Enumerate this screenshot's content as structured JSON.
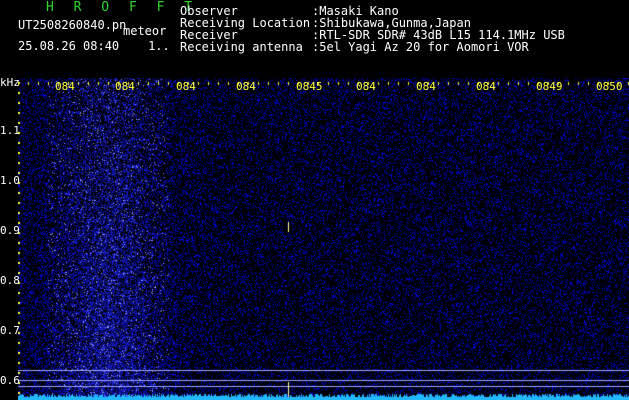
{
  "header": {
    "title": "H R O F F T",
    "filename": "UT2508260840.pn",
    "tag": "meteor",
    "datetime": "25.08.26 08:40",
    "counter": "1.."
  },
  "info": [
    {
      "label": "Observer",
      "value": ":Masaki Kano"
    },
    {
      "label": "Receiving Location",
      "value": ":Shibukawa,Gunma,Japan"
    },
    {
      "label": "Receiver",
      "value": ":RTL-SDR SDR# 43dB L15 114.1MHz USB"
    },
    {
      "label": "Receiving antenna",
      "value": ":5el Yagi Az 20 for Aomori VOR"
    }
  ],
  "axis": {
    "unit": "kHz",
    "time_ticks": [
      "084",
      "084",
      "084",
      "084",
      "0845",
      "084",
      "084",
      "084",
      "0849",
      "0850"
    ],
    "freq_ticks": [
      "1.1",
      "1.0",
      "0.9",
      "0.8",
      "0.7",
      "0.6"
    ]
  },
  "colors": {
    "title": "#2fd62f",
    "text": "#ffffff",
    "tick": "#ffff33",
    "axis": "#ffff33",
    "noise": "#1a1adc",
    "bright": "#6a78ff",
    "trace": "#22b8ff",
    "hline": "#9aa6ff"
  }
}
